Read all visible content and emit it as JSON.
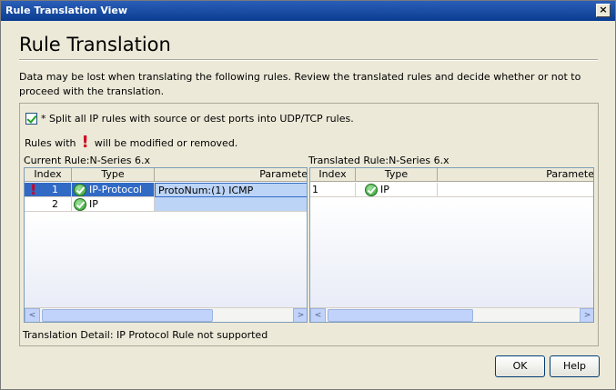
{
  "window": {
    "title": "Rule Translation View",
    "close_glyph": "×"
  },
  "heading": "Rule Translation",
  "description": "Data may be lost when translating the following rules.  Review the translated rules and decide whether or not to proceed with the translation.",
  "split_option": {
    "checked": true,
    "label": "* Split all IP rules with source or dest ports into UDP/TCP rules."
  },
  "legend": {
    "prefix": "Rules with",
    "bang": "!",
    "suffix": "will be modified or removed."
  },
  "current": {
    "label": "Current Rule:N-Series  6.x",
    "columns": [
      "Index",
      "Type",
      "Paramete"
    ],
    "rows": [
      {
        "flag": "!",
        "index": "1",
        "type": "IP-Protocol",
        "params": "ProtoNum:(1) ICMP",
        "icon": "ok-check-icon"
      },
      {
        "flag": "",
        "index": "2",
        "type": "IP",
        "params": "",
        "icon": "ok-check-icon"
      }
    ]
  },
  "translated": {
    "label": "Translated Rule:N-Series  6.x",
    "columns": [
      "Index",
      "Type",
      "Paramete"
    ],
    "rows": [
      {
        "index": "1",
        "type": "IP",
        "params": "",
        "icon": "ok-check-icon"
      }
    ]
  },
  "detail": "Translation Detail:  IP Protocol Rule not supported",
  "buttons": {
    "ok": "OK",
    "help": "Help"
  },
  "scroll": {
    "left": "<",
    "right": ">"
  }
}
